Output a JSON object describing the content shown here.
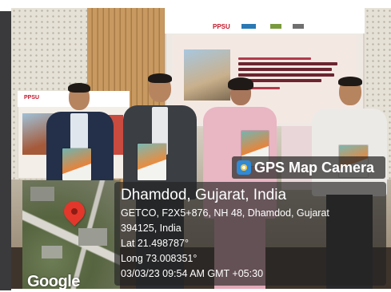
{
  "screen": {
    "logo": "PPSU"
  },
  "banner": {
    "logo": "PPSU"
  },
  "map": {
    "logo": "Google"
  },
  "gps": {
    "title": "GPS Map Camera",
    "place": "Dhamdod, Gujarat, India",
    "address_line1": "GETCO, F2X5+876, NH 48, Dhamdod, Gujarat",
    "address_line2": "394125, India",
    "latitude": "Lat 21.498787°",
    "longitude": "Long 73.008351°",
    "timestamp": "03/03/23 09:54 AM GMT +05:30"
  },
  "colors": {
    "pin": "#e3372b",
    "panel": "rgba(35,35,35,0.66)",
    "brand_red": "#c2172b"
  }
}
